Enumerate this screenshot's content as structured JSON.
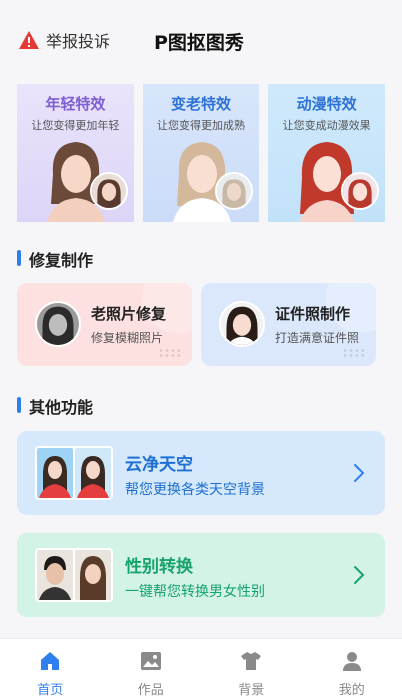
{
  "header": {
    "report_label": "举报投诉",
    "app_title": "P图抠图秀"
  },
  "effects": [
    {
      "title": "年轻特效",
      "subtitle": "让您变得更加年轻"
    },
    {
      "title": "变老特效",
      "subtitle": "让您变得更加成熟"
    },
    {
      "title": "动漫特效",
      "subtitle": "让您变成动漫效果"
    }
  ],
  "repair_section": {
    "title": "修复制作",
    "cards": [
      {
        "title": "老照片修复",
        "subtitle": "修复模糊照片"
      },
      {
        "title": "证件照制作",
        "subtitle": "打造满意证件照"
      }
    ]
  },
  "other_section": {
    "title": "其他功能",
    "cards": [
      {
        "title": "云净天空",
        "subtitle": "帮您更换各类天空背景"
      },
      {
        "title": "性别转换",
        "subtitle": "一键帮您转换男女性别"
      }
    ]
  },
  "tabbar": {
    "items": [
      {
        "label": "首页",
        "icon": "home-icon",
        "active": true
      },
      {
        "label": "作品",
        "icon": "image-icon",
        "active": false
      },
      {
        "label": "背景",
        "icon": "shirt-icon",
        "active": false
      },
      {
        "label": "我的",
        "icon": "user-icon",
        "active": false
      }
    ]
  },
  "colors": {
    "accent": "#2f80ed",
    "warning": "#e53935",
    "repair_old_bg": "#fde1e1",
    "repair_id_bg": "#dbe8fb",
    "sky_bg": "#d6e9fc",
    "gender_bg": "#d2f3e6"
  }
}
